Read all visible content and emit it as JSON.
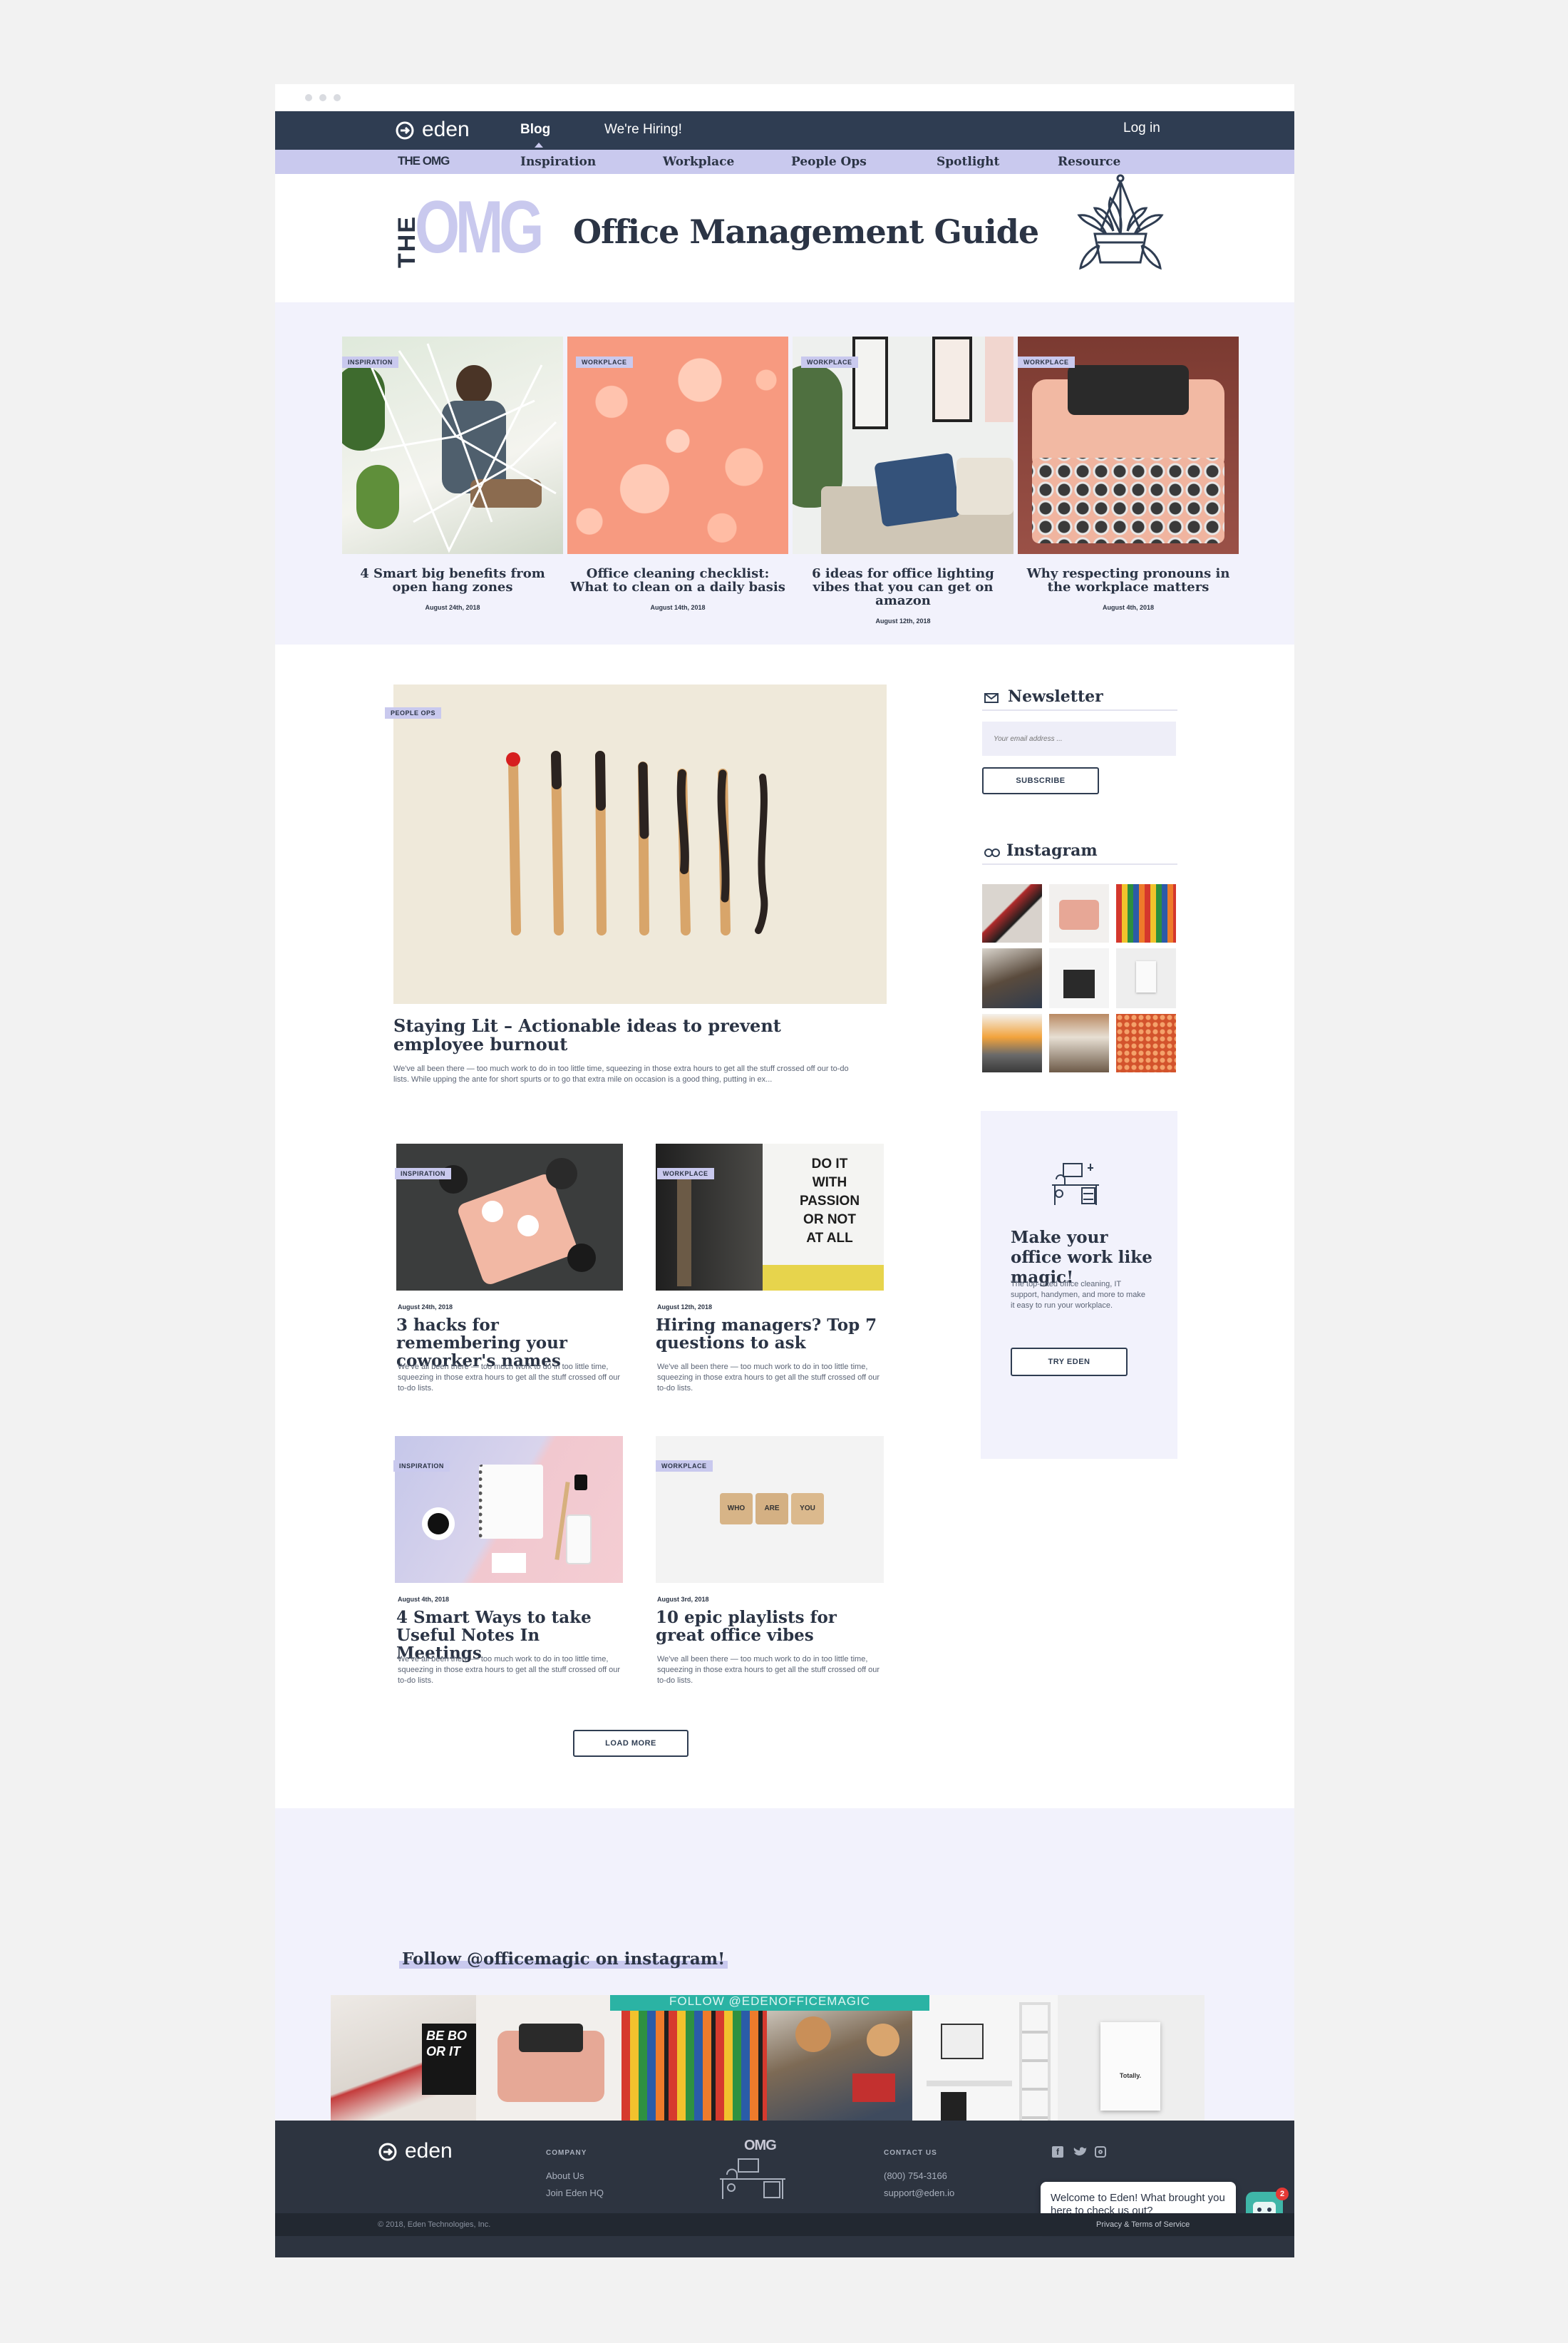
{
  "nav": {
    "brand": "eden",
    "blog": "Blog",
    "hiring": "We're Hiring!",
    "login": "Log in",
    "sub_brand": "THE OMG",
    "sub_items": [
      "Inspiration",
      "Workplace",
      "People Ops",
      "Spotlight",
      "Resource"
    ]
  },
  "header": {
    "logo_the": "THE",
    "logo_omg": "OMG",
    "title": "Office Management Guide"
  },
  "featured": [
    {
      "tag": "INSPIRATION",
      "title": "4 Smart big benefits from open hang zones",
      "date": "August 24th, 2018"
    },
    {
      "tag": "WORKPLACE",
      "title": "Office cleaning checklist: What to clean on a daily basis",
      "date": "August 14th, 2018"
    },
    {
      "tag": "WORKPLACE",
      "title": "6 ideas for office lighting vibes that you can get on amazon",
      "date": "August 12th, 2018"
    },
    {
      "tag": "WORKPLACE",
      "title": "Why respecting pronouns in the workplace matters",
      "date": "August 4th, 2018"
    }
  ],
  "hero_post": {
    "tag": "PEOPLE OPS",
    "title": "Staying Lit – Actionable ideas to prevent employee burnout",
    "excerpt": "We've all been there — too much work to do in too little time, squeezing in those extra hours to get all the stuff crossed off our to-do lists. While upping the ante for short spurts or to go that extra mile on occasion is a good thing, putting in ex..."
  },
  "posts": [
    {
      "tag": "INSPIRATION",
      "date": "August 24th, 2018",
      "title": "3 hacks for remembering your coworker's names",
      "excerpt": "We've all been there — too much work to do in too little time, squeezing in those extra hours to get all the stuff crossed off our to-do lists."
    },
    {
      "tag": "WORKPLACE",
      "date": "August 12th, 2018",
      "title": "Hiring managers? Top 7 questions to ask",
      "excerpt": "We've all been there — too much work to do in too little time, squeezing in those extra hours to get all the stuff crossed off our to-do lists."
    },
    {
      "tag": "INSPIRATION",
      "date": "August 4th, 2018",
      "title": "4 Smart Ways to take Useful Notes In Meetings",
      "excerpt": "We've all been there — too much work to do in too little time, squeezing in those extra hours to get all the stuff crossed off our to-do lists."
    },
    {
      "tag": "WORKPLACE",
      "date": "August 3rd, 2018",
      "title": "10 epic playlists for great office vibes",
      "excerpt": "We've all been there — too much work to do in too little time, squeezing in those extra hours to get all the stuff crossed off our to-do lists."
    }
  ],
  "sign_text": [
    "DO IT",
    "WITH",
    "PASSION",
    "OR NOT",
    "AT ALL"
  ],
  "blocks_text": [
    "WHO",
    "ARE",
    "YOU"
  ],
  "load_more": "LOAD MORE",
  "sidebar": {
    "newsletter_title": "Newsletter",
    "email_placeholder": "Your email address ...",
    "subscribe": "SUBSCRIBE",
    "instagram_title": "Instagram",
    "promo_title": "Make your office work like magic!",
    "promo_text": "The top-rated office cleaning, IT support, handymen, and more to make it easy to run your workplace.",
    "promo_button": "TRY EDEN"
  },
  "insta_band": {
    "title": "Follow @officemagic on instagram!",
    "overlay": "FOLLOW @EDENOFFICEMAGIC",
    "typewriter_text": [
      "BE BO",
      "OR IT"
    ],
    "notebook_text": "Totally."
  },
  "footer": {
    "brand": "eden",
    "company_head": "COMPANY",
    "company_links": [
      "About Us",
      "Join Eden HQ"
    ],
    "omg": "OMG",
    "contact_head": "CONTACT US",
    "phone": "(800) 754-3166",
    "email": "support@eden.io",
    "chat_text": "Welcome to Eden! What brought you here to check us out?",
    "chat_badge": "2",
    "copyright": "© 2018, Eden Technologies, Inc.",
    "legal": "Privacy & Terms of Service"
  },
  "colors": {
    "navy": "#2f3d52",
    "lavender": "#c9c9ee",
    "pale": "#f2f2fc",
    "footer": "#2d3440"
  }
}
